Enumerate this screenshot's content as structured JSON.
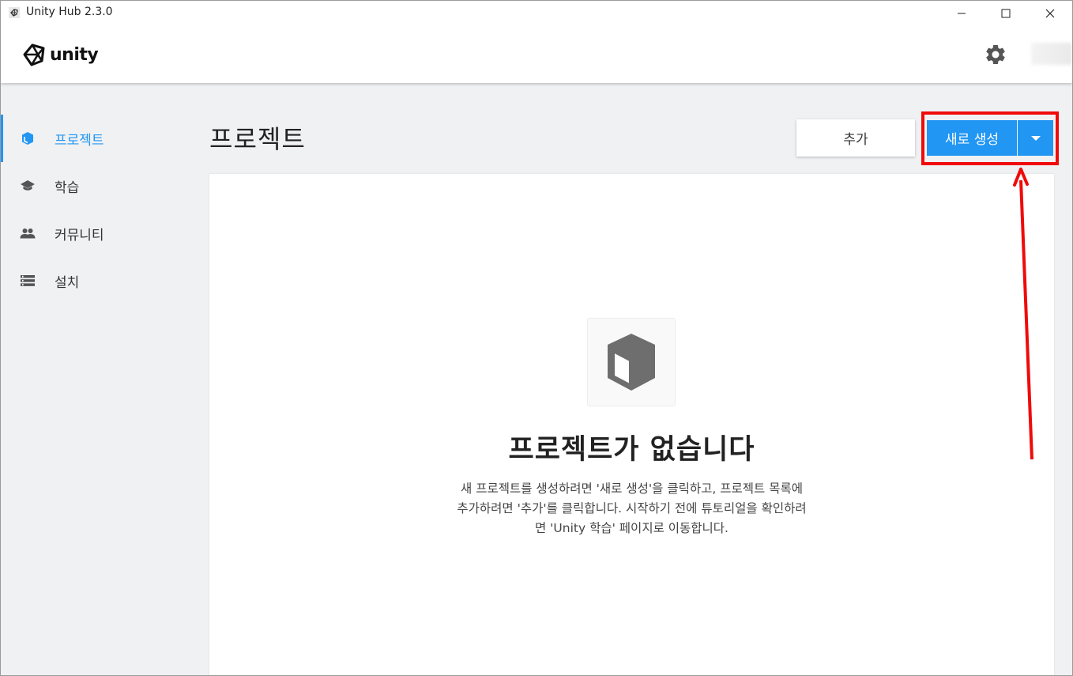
{
  "window": {
    "title": "Unity Hub 2.3.0"
  },
  "header": {
    "logo_text": "unity"
  },
  "sidebar": {
    "items": [
      {
        "label": "프로젝트",
        "icon": "cube-icon",
        "active": true
      },
      {
        "label": "학습",
        "icon": "graduation-cap-icon",
        "active": false
      },
      {
        "label": "커뮤니티",
        "icon": "people-icon",
        "active": false
      },
      {
        "label": "설치",
        "icon": "list-icon",
        "active": false
      }
    ]
  },
  "main": {
    "title": "프로젝트",
    "add_label": "추가",
    "new_label": "새로 생성",
    "empty_title": "프로젝트가 없습니다",
    "empty_desc_lines": [
      "새 프로젝트를 생성하려면 '새로 생성'을 클릭하고, 프로젝트 목록에",
      "추가하려면 '추가'를 클릭합니다. 시작하기 전에 튜토리얼을 확인하려",
      "면 'Unity 학습' 페이지로 이동합니다."
    ]
  },
  "colors": {
    "accent": "#2196f3",
    "annotation": "#f00a0a",
    "sidebar_bg": "#f0f1f3"
  }
}
